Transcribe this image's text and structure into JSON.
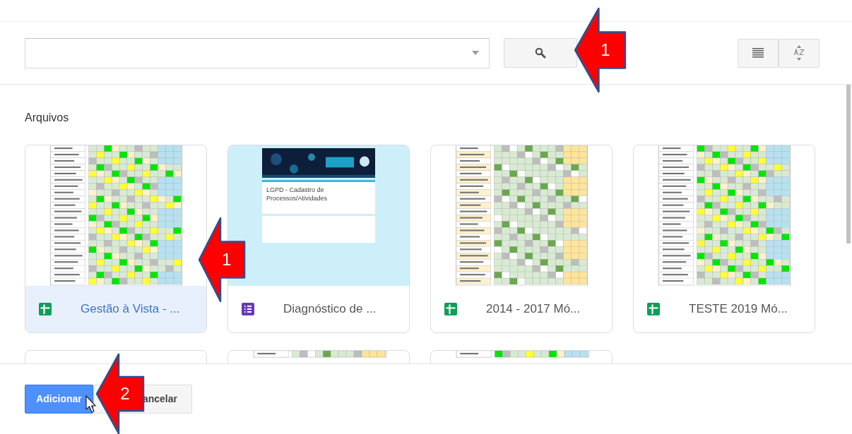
{
  "section_title": "Arquivos",
  "files": [
    {
      "title": "Gestão à Vista - ...",
      "kind": "spreadsheet",
      "selected": true
    },
    {
      "title": "Diagnóstico de ...",
      "kind": "form",
      "selected": false,
      "preview_title": "LGPD - Cadastro de Processos/Atividades"
    },
    {
      "title": "2014 - 2017 Mó...",
      "kind": "spreadsheet",
      "selected": false
    },
    {
      "title": "TESTE 2019 Mó...",
      "kind": "spreadsheet",
      "selected": false
    }
  ],
  "more_files": [
    {
      "kind": "blank"
    },
    {
      "kind": "spreadsheet"
    },
    {
      "kind": "spreadsheet"
    }
  ],
  "buttons": [
    {
      "label": "Adicionar",
      "kind": "primary"
    },
    {
      "label": "ancelar",
      "kind": "secondary"
    }
  ],
  "annotations": [
    {
      "number": "1"
    },
    {
      "number": "1"
    },
    {
      "number": "2"
    }
  ]
}
